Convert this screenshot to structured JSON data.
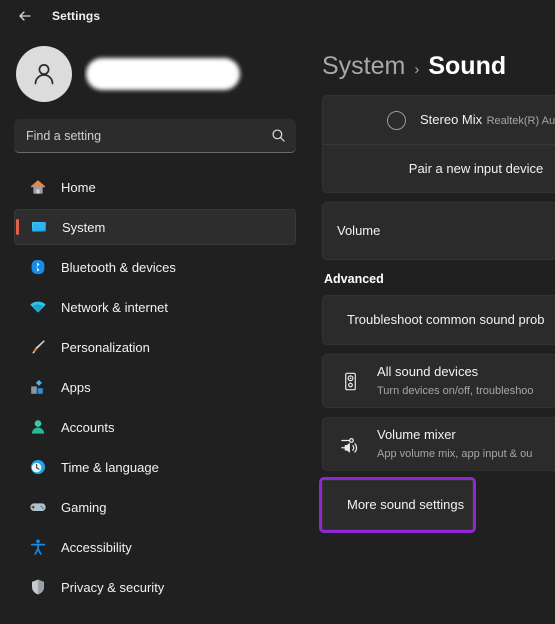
{
  "titlebar": {
    "back_icon": "back-arrow-icon",
    "title": "Settings"
  },
  "sidebar": {
    "account": {
      "name": "",
      "avatar_icon": "person-avatar-icon",
      "redacted": true
    },
    "search": {
      "placeholder": "Find a setting",
      "value": "",
      "icon": "search-icon"
    },
    "items": [
      {
        "label": "Home",
        "icon": "home-icon",
        "selected": false
      },
      {
        "label": "System",
        "icon": "system-icon",
        "selected": true
      },
      {
        "label": "Bluetooth & devices",
        "icon": "bluetooth-icon",
        "selected": false
      },
      {
        "label": "Network & internet",
        "icon": "network-icon",
        "selected": false
      },
      {
        "label": "Personalization",
        "icon": "paintbrush-icon",
        "selected": false
      },
      {
        "label": "Apps",
        "icon": "apps-icon",
        "selected": false
      },
      {
        "label": "Accounts",
        "icon": "accounts-icon",
        "selected": false
      },
      {
        "label": "Time & language",
        "icon": "clock-icon",
        "selected": false
      },
      {
        "label": "Gaming",
        "icon": "gamepad-icon",
        "selected": false
      },
      {
        "label": "Accessibility",
        "icon": "accessibility-icon",
        "selected": false
      },
      {
        "label": "Privacy & security",
        "icon": "shield-icon",
        "selected": false
      }
    ]
  },
  "main": {
    "breadcrumb": {
      "parent": "System",
      "separator": "›",
      "current": "Sound"
    },
    "input_card": {
      "device": {
        "title": "Stereo Mix",
        "subtitle": "Realtek(R) Audio",
        "selected": false
      },
      "pair_label": "Pair a new input device"
    },
    "volume_card": {
      "label": "Volume"
    },
    "advanced": {
      "header": "Advanced",
      "items": [
        {
          "title": "Troubleshoot common sound prob",
          "subtitle": "",
          "icon": ""
        },
        {
          "title": "All sound devices",
          "subtitle": "Turn devices on/off, troubleshoo",
          "icon": "speaker-devices-icon"
        },
        {
          "title": "Volume mixer",
          "subtitle": "App volume mix, app input & ou",
          "icon": "volume-mixer-icon"
        },
        {
          "title": "More sound settings",
          "subtitle": "",
          "icon": "",
          "highlighted": true
        }
      ]
    }
  },
  "colors": {
    "background": "#202020",
    "card": "#2b2b2b",
    "accent_bar": "#e0624c",
    "annotation": "#9126d4",
    "text_primary": "#f2f2f2",
    "text_secondary": "#a6a6a6"
  }
}
